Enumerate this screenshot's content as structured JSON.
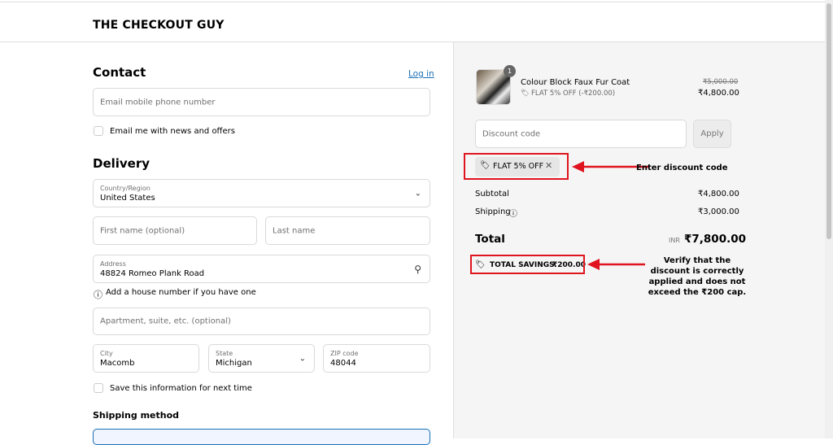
{
  "header": {
    "brand": "THE CHECKOUT GUY"
  },
  "contact": {
    "title": "Contact",
    "login": "Log in",
    "email_placeholder": "Email mobile phone number",
    "news_label": "Email me with news and offers"
  },
  "delivery": {
    "title": "Delivery",
    "country_label": "Country/Region",
    "country_value": "United States",
    "first_name_placeholder": "First name (optional)",
    "last_name_placeholder": "Last name",
    "address_label": "Address",
    "address_value": "48824 Romeo Plank Road",
    "address_hint": "Add a house number if you have one",
    "apartment_placeholder": "Apartment, suite, etc. (optional)",
    "city_label": "City",
    "city_value": "Macomb",
    "state_label": "State",
    "state_value": "Michigan",
    "zip_label": "ZIP code",
    "zip_value": "48044",
    "save_label": "Save this information for next time"
  },
  "shipping": {
    "title": "Shipping method"
  },
  "summary": {
    "item": {
      "quantity": "1",
      "name": "Colour Block Faux Fur Coat",
      "discount": "FLAT 5% OFF (-₹200.00)",
      "original_price": "₹5,000.00",
      "price": "₹4,800.00"
    },
    "discount_placeholder": "Discount code",
    "apply": "Apply",
    "chip": "FLAT 5% OFF",
    "subtotal_label": "Subtotal",
    "subtotal": "₹4,800.00",
    "shipping_label": "Shipping",
    "shipping": "₹3,000.00",
    "total_label": "Total",
    "currency": "INR",
    "total": "₹7,800.00",
    "savings_label": "TOTAL SAVINGS",
    "savings": "₹200.00"
  },
  "annotations": {
    "a1": "Enter discount code",
    "a2": "Verify that the discount is correctly applied and does not exceed the ₹200 cap."
  }
}
